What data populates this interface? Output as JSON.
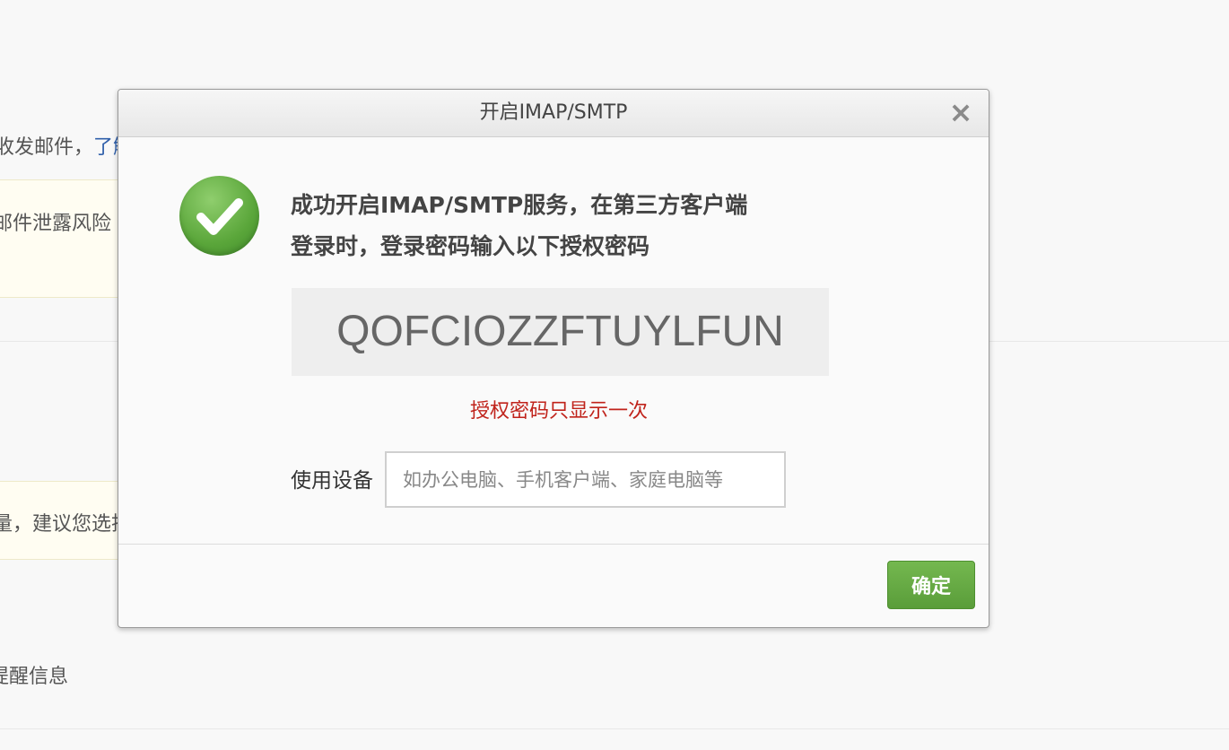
{
  "background": {
    "line1": "收发邮件，",
    "line1_link": "了解",
    "yellow1": "邮件泄露风险",
    "yellow2": "量，建议您选择",
    "line_bottom": "提醒信息"
  },
  "dialog": {
    "title": "开启IMAP/SMTP",
    "close_glyph": "×",
    "icon": "check-icon",
    "message_line1": "成功开启IMAP/SMTP服务，在第三方客户端",
    "message_line2": "登录时，登录密码输入以下授权密码",
    "auth_code": "QOFCIOZZFTUYLFUN",
    "warning": "授权密码只显示一次",
    "device_label": "使用设备",
    "device_placeholder": "如办公电脑、手机客户端、家庭电脑等",
    "device_value": "",
    "ok_label": "确定"
  },
  "colors": {
    "accent_green": "#5a9d3a",
    "warning_red": "#c0231b",
    "link_blue": "#2f5faa"
  }
}
